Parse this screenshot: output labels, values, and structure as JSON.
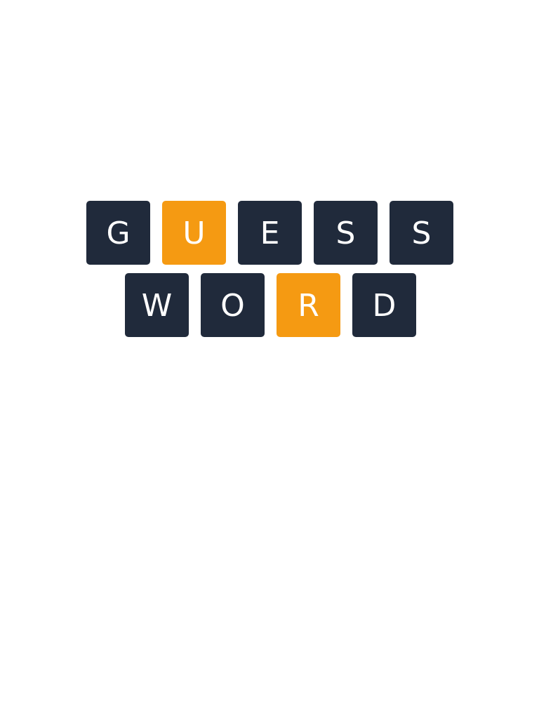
{
  "logo": {
    "rows": [
      {
        "tiles": [
          {
            "letter": "G",
            "state": "dark"
          },
          {
            "letter": "U",
            "state": "orange"
          },
          {
            "letter": "E",
            "state": "dark"
          },
          {
            "letter": "S",
            "state": "dark"
          },
          {
            "letter": "S",
            "state": "dark"
          }
        ]
      },
      {
        "tiles": [
          {
            "letter": "W",
            "state": "dark"
          },
          {
            "letter": "O",
            "state": "dark"
          },
          {
            "letter": "R",
            "state": "orange"
          },
          {
            "letter": "D",
            "state": "dark"
          }
        ]
      }
    ]
  },
  "colors": {
    "dark_tile": "#202a3b",
    "orange_tile": "#f59a12",
    "letter": "#ffffff",
    "background": "#ffffff"
  }
}
